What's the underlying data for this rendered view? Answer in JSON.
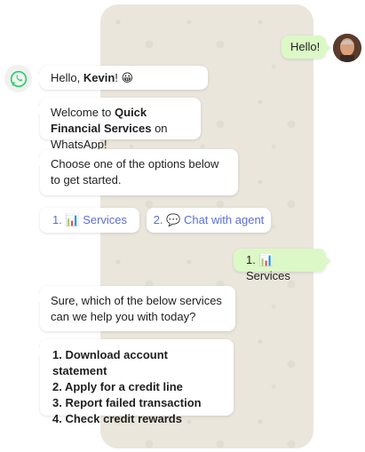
{
  "colors": {
    "chat_bg": "#eae6dc",
    "outgoing": "#dcf8c6",
    "link": "#5a6fd6",
    "whatsapp_green": "#25d366"
  },
  "messages": {
    "hello_out": "Hello!",
    "greet_prefix": "Hello, ",
    "greet_name": "Kevin",
    "greet_suffix": "! 😀",
    "welcome_prefix": "Welcome to ",
    "welcome_brand": "Quick Financial Services",
    "welcome_suffix": " on WhatsApp!",
    "choose": "Choose one of the options below to get started.",
    "selected_out": "1. 📊 Services",
    "sure": "Sure, which of the below services can we help you with today?"
  },
  "options": [
    {
      "label": "1. 📊 Services"
    },
    {
      "label": "2. 💬 Chat with agent"
    }
  ],
  "services": [
    "1. Download account statement",
    "2. Apply for a credit line",
    "3. Report failed transaction",
    "4. Check credit rewards"
  ],
  "icons": {
    "brand": "whatsapp-icon",
    "user": "avatar"
  }
}
